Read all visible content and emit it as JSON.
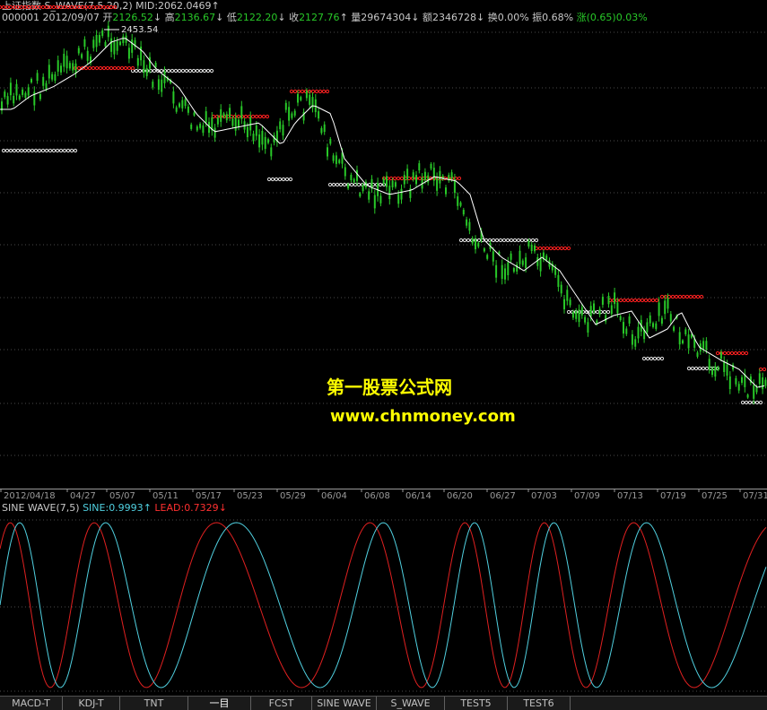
{
  "header": {
    "line1": {
      "name": "上证指数",
      "indicator": "S_WAVE(7,5,20,2)",
      "mid_label": "MID:",
      "mid_value": "2062.0469",
      "mid_arrow": "↑"
    },
    "line2": {
      "code": "000001",
      "date": "2012/09/07",
      "open_label": "开",
      "open_value": "2126.52",
      "open_arrow": "↓",
      "high_label": "高",
      "high_value": "2136.67",
      "high_arrow": "↓",
      "low_label": "低",
      "low_value": "2122.20",
      "low_arrow": "↓",
      "close_label": "收",
      "close_value": "2127.76",
      "close_arrow": "↑",
      "vol_label": "量",
      "vol_value": "29674304",
      "vol_arrow": "↓",
      "amt_label": "额",
      "amt_value": "2346728",
      "amt_arrow": "↓",
      "turnover_label": "换",
      "turnover_value": "0.00%",
      "amp_label": "振",
      "amp_value": "0.68%",
      "chg_label": "涨",
      "chg_value": "(0.65)0.03%"
    }
  },
  "price_annotation": "2453.54",
  "date_axis": [
    "2012/04/18",
    "04/27",
    "05/07",
    "05/11",
    "05/17",
    "05/23",
    "05/29",
    "06/04",
    "06/08",
    "06/14",
    "06/20",
    "06/27",
    "07/03",
    "07/09",
    "07/13",
    "07/19",
    "07/25",
    "07/31"
  ],
  "indicator_header": {
    "name": "SINE WAVE(7,5)",
    "sine_label": "SINE:",
    "sine_value": "0.9993",
    "sine_arrow": "↑",
    "lead_label": "LEAD:",
    "lead_value": "0.7329",
    "lead_arrow": "↓"
  },
  "watermark": {
    "title": "第一股票公式网",
    "url": "www.chnmoney.com"
  },
  "tabs": [
    {
      "label": "MACD-T",
      "active": false
    },
    {
      "label": "KDJ-T",
      "active": false
    },
    {
      "label": "TNT",
      "active": false
    },
    {
      "label": "一目",
      "active": true
    },
    {
      "label": "FCST",
      "active": false
    },
    {
      "label": "SINE WAVE",
      "active": false
    },
    {
      "label": "S_WAVE",
      "active": false
    },
    {
      "label": "TEST5",
      "active": false
    },
    {
      "label": "TEST6",
      "active": false
    }
  ],
  "colors": {
    "background": "#000000",
    "candle": "#28c828",
    "mid_line": "#ffffff",
    "band_red": "#ff2020",
    "band_white": "#dcdcdc",
    "sine": "#50d0e0",
    "lead": "#e02020",
    "grid": "#4a4a4a",
    "watermark": "#ffff00"
  }
}
